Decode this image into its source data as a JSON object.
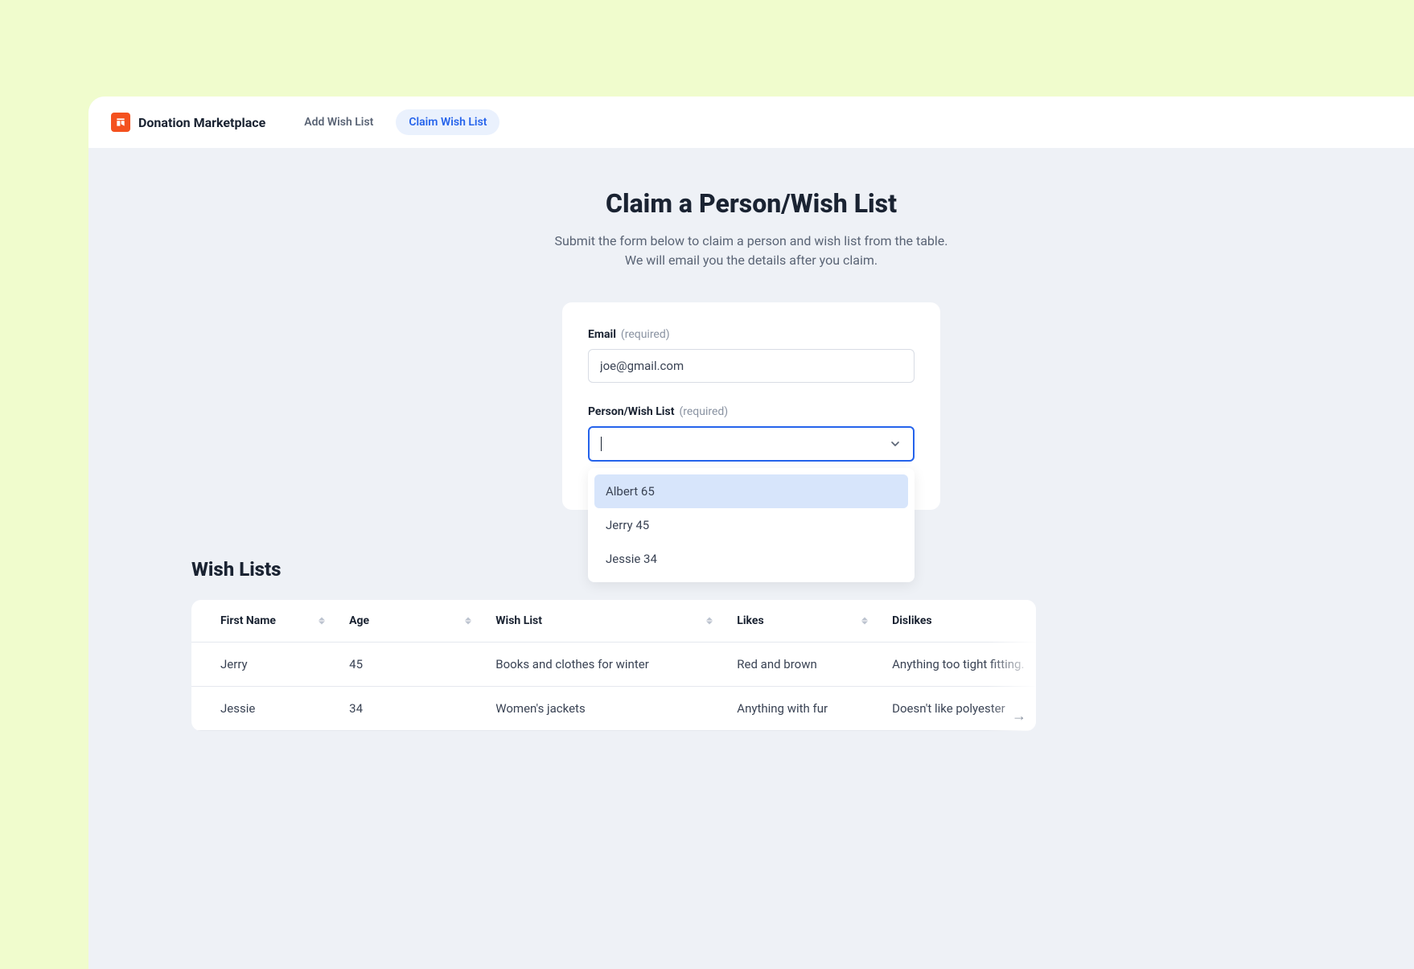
{
  "brand": {
    "name": "Donation Marketplace"
  },
  "nav": {
    "items": [
      {
        "label": "Add Wish List",
        "active": false
      },
      {
        "label": "Claim Wish List",
        "active": true
      }
    ]
  },
  "page": {
    "title": "Claim a Person/Wish List",
    "subtitle": "Submit the form below to claim a person and wish list from the table. We will email you the details after you claim."
  },
  "form": {
    "email": {
      "label": "Email",
      "required_text": "(required)",
      "value": "joe@gmail.com"
    },
    "person": {
      "label": "Person/Wish List",
      "required_text": "(required)",
      "options": [
        {
          "label": "Albert 65",
          "highlighted": true
        },
        {
          "label": "Jerry 45",
          "highlighted": false
        },
        {
          "label": "Jessie 34",
          "highlighted": false
        }
      ]
    }
  },
  "wishlists": {
    "section_title": "Wish Lists",
    "columns": [
      "First Name",
      "Age",
      "Wish List",
      "Likes",
      "Dislikes"
    ],
    "rows": [
      {
        "first_name": "Jerry",
        "age": "45",
        "wish_list": "Books and clothes for winter",
        "likes": "Red and brown",
        "dislikes": "Anything too tight fitting."
      },
      {
        "first_name": "Jessie",
        "age": "34",
        "wish_list": "Women's jackets",
        "likes": "Anything with fur",
        "dislikes": "Doesn't like polyester"
      }
    ]
  }
}
